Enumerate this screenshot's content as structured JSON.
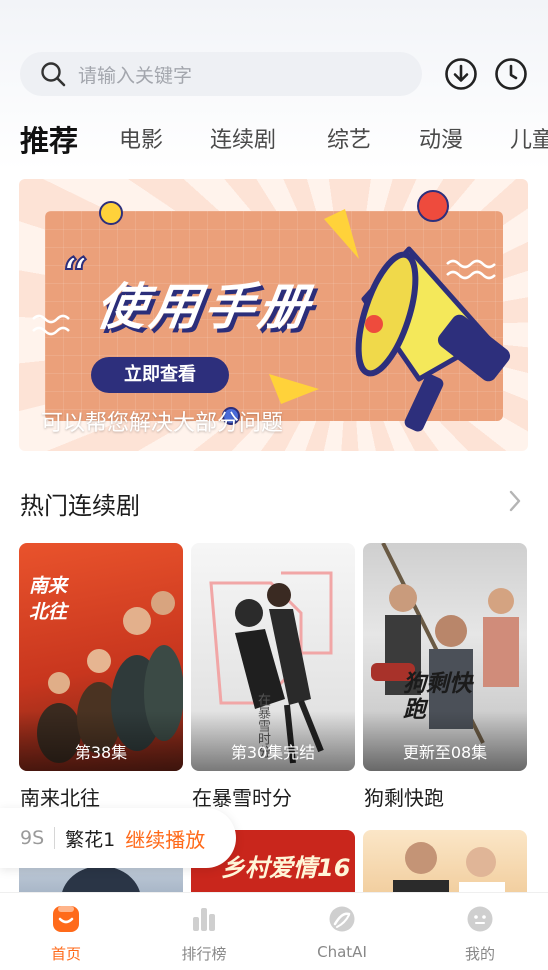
{
  "search": {
    "placeholder": "请输入关键字"
  },
  "header_icons": [
    "download-icon",
    "history-icon"
  ],
  "tabs": [
    "推荐",
    "电影",
    "连续剧",
    "综艺",
    "动漫",
    "儿童"
  ],
  "active_tab": "推荐",
  "banner": {
    "headline": "使用手册",
    "button_label": "立即查看",
    "caption": "可以帮您解决大部分问题"
  },
  "section": {
    "title": "热门连续剧"
  },
  "dramas": [
    {
      "title": "南来北往",
      "episode": "第38集",
      "poster_text": "南来\n北往"
    },
    {
      "title": "在暴雪时分",
      "episode": "第30集完结",
      "poster_text": "在暴雪时分"
    },
    {
      "title": "狗剩快跑",
      "episode": "更新至08集",
      "poster_text": "狗剩快跑"
    }
  ],
  "row2_posters": [
    "",
    "乡村爱情16",
    ""
  ],
  "resume_bar": {
    "episode": "9S",
    "show": "繁花1",
    "action": "继续播放"
  },
  "bottom_nav": [
    {
      "label": "首页",
      "icon": "home-icon",
      "active": true
    },
    {
      "label": "排行榜",
      "icon": "ranking-icon",
      "active": false
    },
    {
      "label": "ChatAI",
      "icon": "chatai-icon",
      "active": false
    },
    {
      "label": "我的",
      "icon": "profile-icon",
      "active": false
    }
  ],
  "colors": {
    "accent": "#ff6a1a",
    "banner_dark": "#2d2f7c"
  }
}
